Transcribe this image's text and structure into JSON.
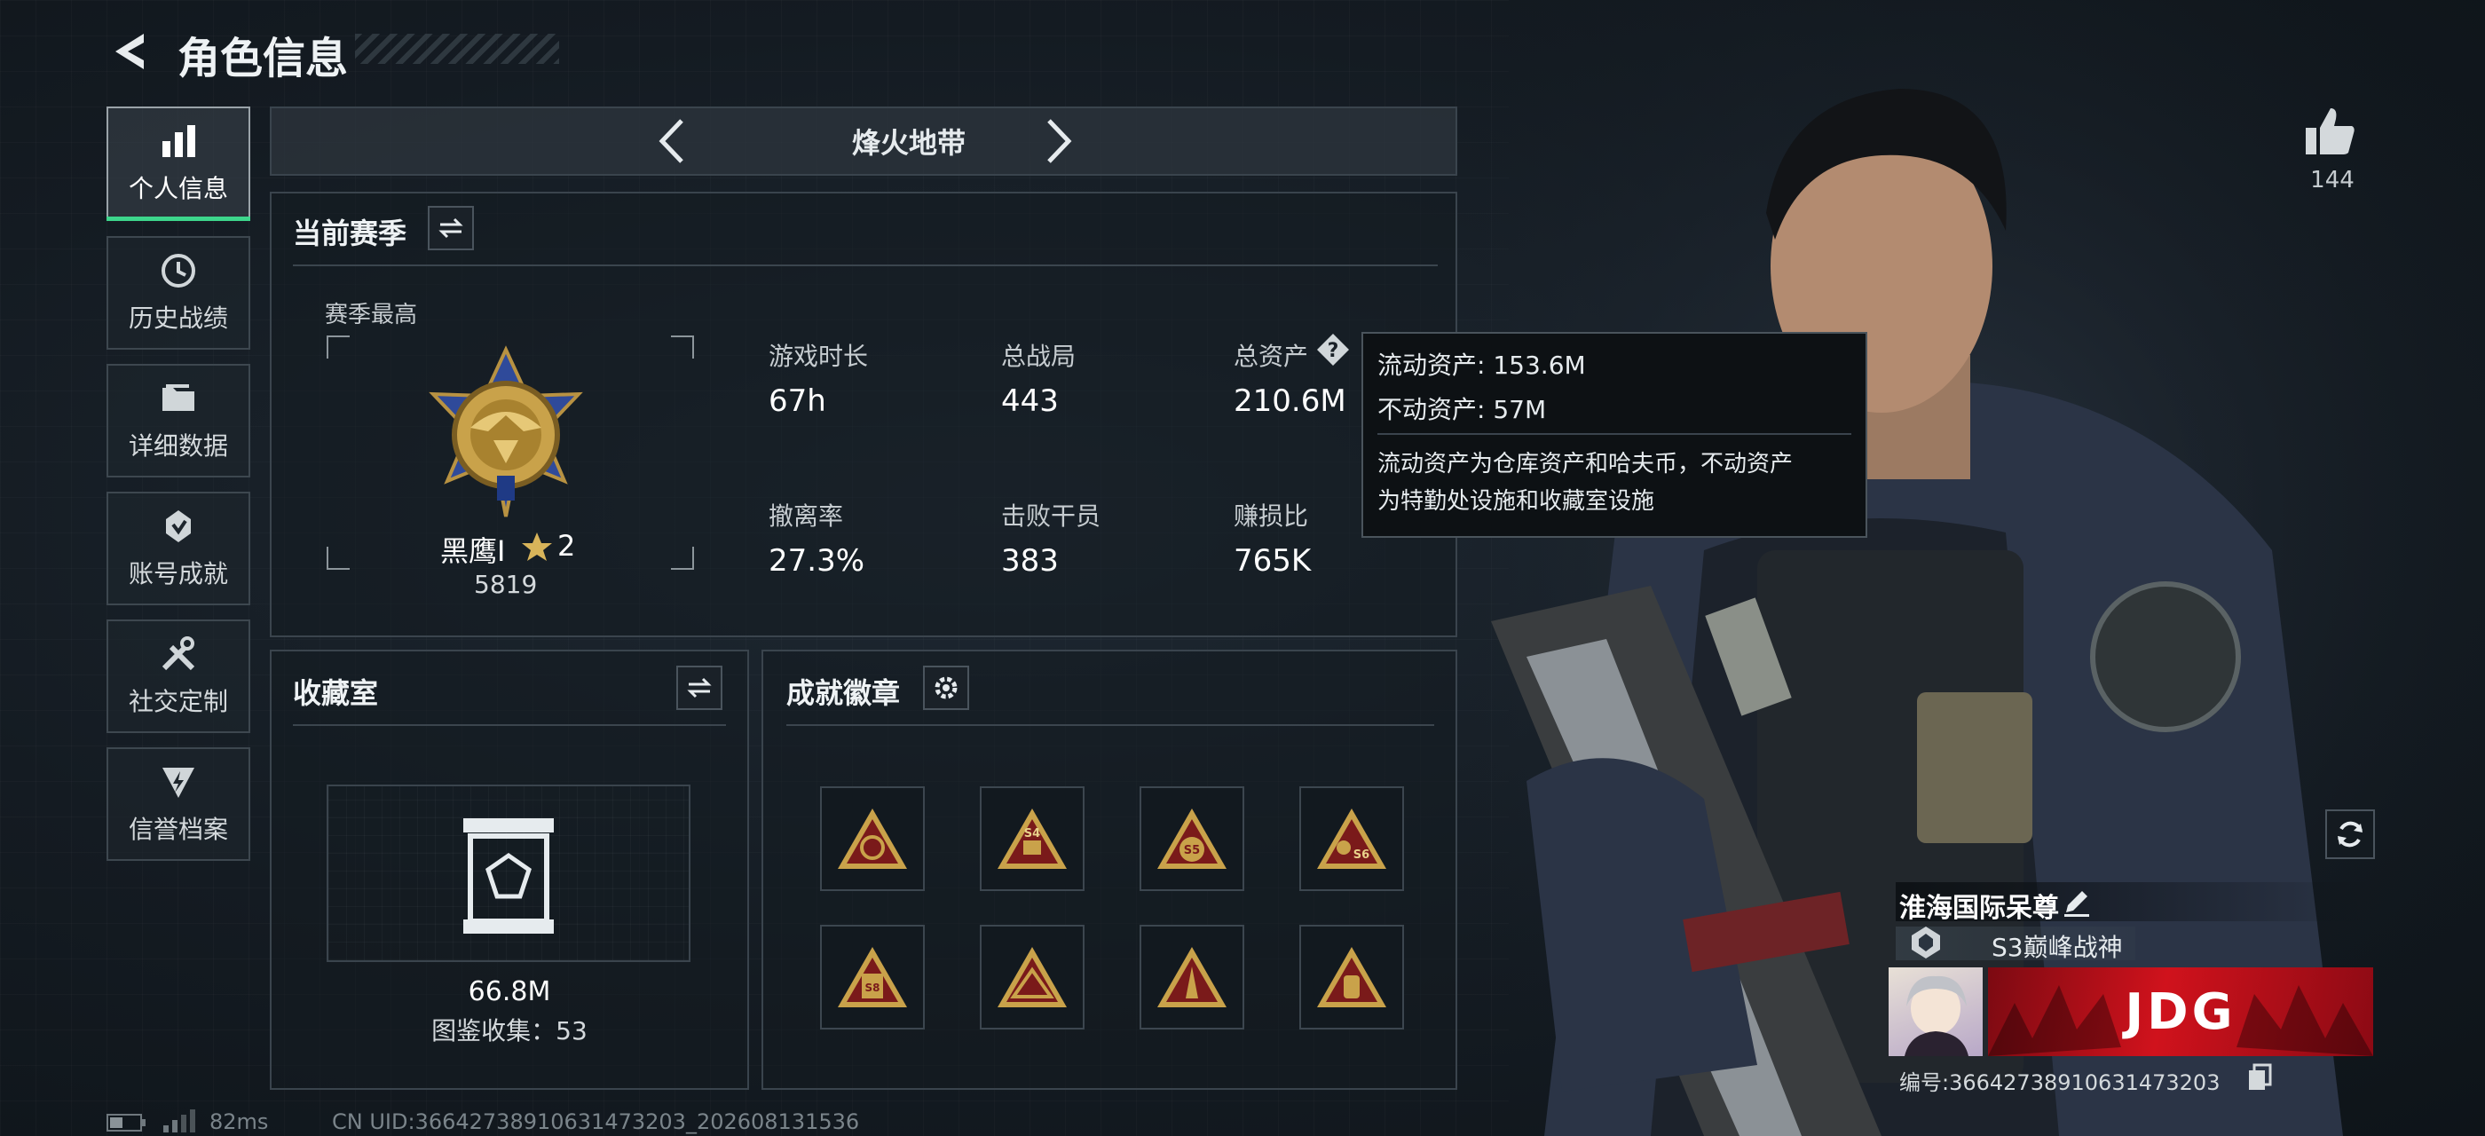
{
  "header": {
    "title": "角色信息"
  },
  "sidebar": {
    "items": [
      {
        "label": "个人信息",
        "icon": "bar-chart-icon"
      },
      {
        "label": "历史战绩",
        "icon": "history-clock-icon"
      },
      {
        "label": "详细数据",
        "icon": "folder-icon"
      },
      {
        "label": "账号成就",
        "icon": "achievement-icon"
      },
      {
        "label": "社交定制",
        "icon": "tools-icon"
      },
      {
        "label": "信誉档案",
        "icon": "shield-bolt-icon"
      }
    ]
  },
  "mode_selector": {
    "label": "烽火地带"
  },
  "season": {
    "title": "当前赛季",
    "best_label": "赛季最高",
    "rank_name": "黑鹰I",
    "rank_stars": "2",
    "rank_score": "5819",
    "stats": [
      {
        "label": "游戏时长",
        "value": "67h"
      },
      {
        "label": "总战局",
        "value": "443"
      },
      {
        "label": "总资产",
        "value": "210.6M"
      },
      {
        "label": "撤离率",
        "value": "27.3%"
      },
      {
        "label": "击败干员",
        "value": "383"
      },
      {
        "label": "赚损比",
        "value": "765K"
      }
    ]
  },
  "tooltip": {
    "liquid_label": "流动资产:",
    "liquid_value": "153.6M",
    "fixed_label": "不动资产:",
    "fixed_value": "57M",
    "desc_line1": "流动资产为仓库资产和哈夫币，不动资产",
    "desc_line2": "为特勤处设施和收藏室设施"
  },
  "collection": {
    "title": "收藏室",
    "value": "66.8M",
    "count_text": "图鉴收集：53"
  },
  "badges": {
    "title": "成就徽章",
    "items": [
      {
        "tag": ""
      },
      {
        "tag": "S4"
      },
      {
        "tag": "S5"
      },
      {
        "tag": "S6"
      },
      {
        "tag": "S8"
      },
      {
        "tag": ""
      },
      {
        "tag": ""
      },
      {
        "tag": ""
      }
    ]
  },
  "likes": {
    "count": "144"
  },
  "player": {
    "name": "淮海国际呆尊",
    "title": "S3巅峰战神",
    "banner_text": "JDG",
    "id_text": "编号:36642738910631473203"
  },
  "footer": {
    "ping": "82ms",
    "uid": "CN UID:36642738910631473203_202608131536"
  },
  "colors": {
    "accent_gold": "#c9a24a",
    "badge_red": "#7a1a1a",
    "banner_red": "#c0141e",
    "active_tab_line": "#3dd68c"
  }
}
